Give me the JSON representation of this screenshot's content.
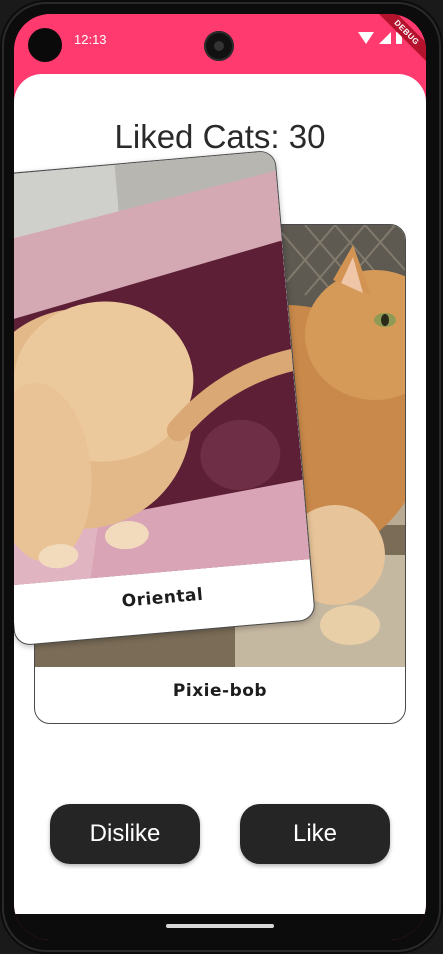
{
  "status_bar": {
    "time": "12:13",
    "debug_label": "DEBUG",
    "accent_color": "#ff3a6e",
    "icons": [
      "wifi-icon",
      "cellular-signal-icon",
      "battery-icon"
    ]
  },
  "header": {
    "title": "Liked Cats: 30"
  },
  "cards": {
    "front": {
      "breed": "Oriental",
      "photo": "orange-cat-on-pink-blanket"
    },
    "back": {
      "breed": "Pixie-bob",
      "photo": "orange-tabby-cat-outdoors"
    }
  },
  "actions": {
    "dislike_label": "Dislike",
    "like_label": "Like"
  }
}
